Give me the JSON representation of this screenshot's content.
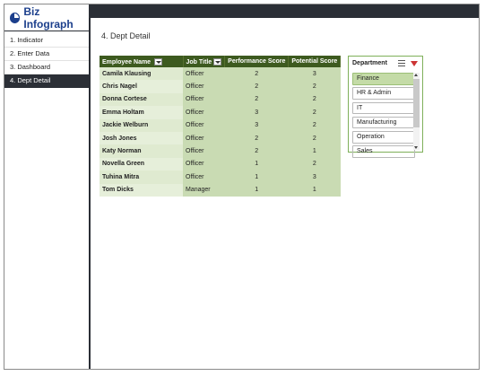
{
  "app": {
    "logo_text": "Biz Infograph"
  },
  "sidebar": {
    "items": [
      {
        "label": "1. Indicator"
      },
      {
        "label": "2. Enter Data"
      },
      {
        "label": "3. Dashboard"
      },
      {
        "label": "4. Dept Detail",
        "active": true
      }
    ]
  },
  "main": {
    "title": "4. Dept Detail",
    "table": {
      "headers": [
        "Employee Name",
        "Job Title",
        "Performance Score",
        "Potential Score"
      ],
      "rows": [
        [
          "Camila Klausing",
          "Officer",
          "2",
          "3"
        ],
        [
          "Chris Nagel",
          "Officer",
          "2",
          "2"
        ],
        [
          "Donna Cortese",
          "Officer",
          "2",
          "2"
        ],
        [
          "Emma Holtam",
          "Officer",
          "3",
          "2"
        ],
        [
          "Jackie Welburn",
          "Officer",
          "3",
          "2"
        ],
        [
          "Josh Jones",
          "Officer",
          "2",
          "2"
        ],
        [
          "Katy Norman",
          "Officer",
          "2",
          "1"
        ],
        [
          "Novella Green",
          "Officer",
          "1",
          "2"
        ],
        [
          "Tuhina Mitra",
          "Officer",
          "1",
          "3"
        ],
        [
          "Tom Dicks",
          "Manager",
          "1",
          "1"
        ]
      ]
    }
  },
  "slicer": {
    "title": "Department",
    "items": [
      {
        "label": "Finance",
        "selected": true
      },
      {
        "label": "HR & Admin"
      },
      {
        "label": "IT"
      },
      {
        "label": "Manufacturing"
      },
      {
        "label": "Operation"
      },
      {
        "label": "Sales"
      }
    ]
  },
  "colors": {
    "header_bar": "#2b2f36",
    "table_header": "#3d5a1f",
    "cell_green": "#c9dbb3",
    "slicer_selected": "#c4dba7",
    "logo_blue": "#1c3f8c"
  }
}
